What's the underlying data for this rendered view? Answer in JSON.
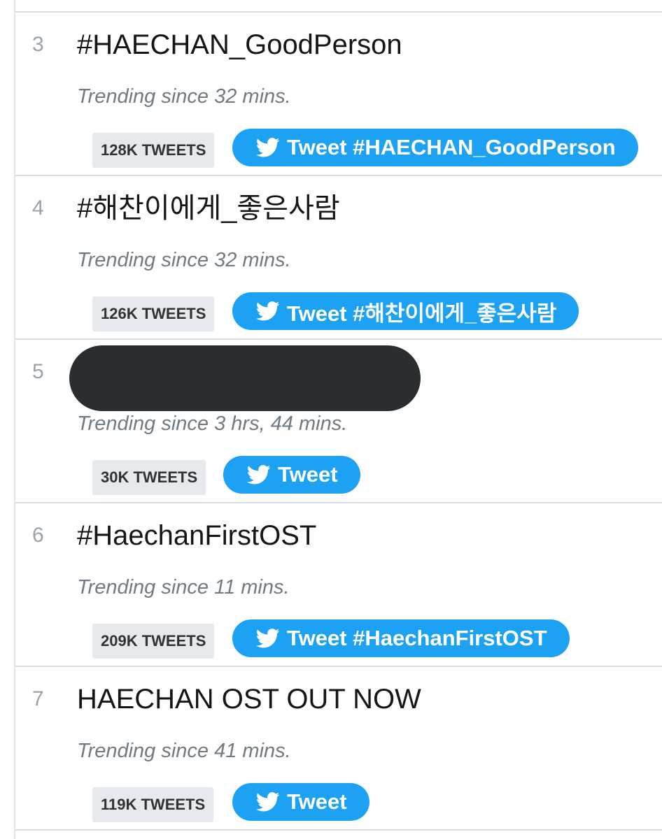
{
  "colors": {
    "accent": "#1da1f2",
    "badge_bg": "#e6e9ed",
    "rank_text": "#9aa3ab",
    "since_text": "#707b84",
    "name_text": "#14171a",
    "divider": "#d9dde1",
    "redaction": "#2b2e31"
  },
  "icons": {
    "tweet_button": "twitter-bird-icon"
  },
  "trends": [
    {
      "rank": "3",
      "name": "#HAECHAN_GoodPerson",
      "since": "Trending since 32 mins.",
      "tweets": "128K TWEETS",
      "button": "Tweet #HAECHAN_GoodPerson",
      "redacted": false
    },
    {
      "rank": "4",
      "name": "#해찬이에게_좋은사람",
      "since": "Trending since 32 mins.",
      "tweets": "126K TWEETS",
      "button": "Tweet #해찬이에게_좋은사람",
      "redacted": false
    },
    {
      "rank": "5",
      "name": "",
      "since": "Trending since 3 hrs, 44 mins.",
      "tweets": "30K TWEETS",
      "button": "Tweet",
      "redacted": true
    },
    {
      "rank": "6",
      "name": "#HaechanFirstOST",
      "since": "Trending since 11 mins.",
      "tweets": "209K TWEETS",
      "button": "Tweet #HaechanFirstOST",
      "redacted": false
    },
    {
      "rank": "7",
      "name": "HAECHAN OST OUT NOW",
      "since": "Trending since 41 mins.",
      "tweets": "119K TWEETS",
      "button": "Tweet",
      "redacted": false
    }
  ]
}
